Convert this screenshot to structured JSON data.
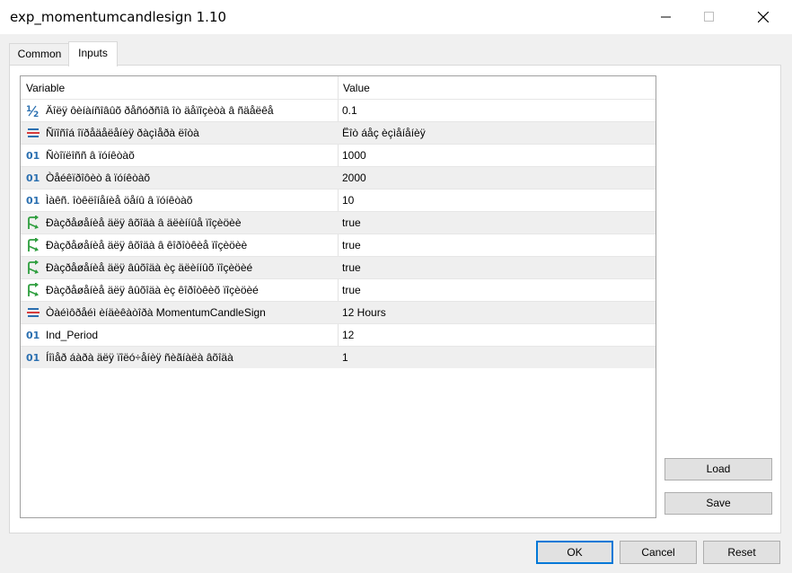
{
  "window": {
    "title": "exp_momentumcandlesign 1.10"
  },
  "tabs": [
    {
      "label": "Common",
      "active": false
    },
    {
      "label": "Inputs",
      "active": true
    }
  ],
  "grid": {
    "columns": {
      "variable": "Variable",
      "value": "Value"
    },
    "rows": [
      {
        "icon": "half-fraction-icon",
        "name": "Äîëÿ ôèíàíñîâûõ ðåñóðñîâ îò äåïîçèòà â ñäåëêå",
        "value": "0.1"
      },
      {
        "icon": "enum-list-icon",
        "name": "Ñïîñîá îïðåäåëåíèÿ ðàçìåðà ëîòà",
        "value": "Ëîò áåç èçìåíåíèÿ"
      },
      {
        "icon": "integer-icon",
        "name": "Ñòîïëîññ â ïóíêòàõ",
        "value": "1000"
      },
      {
        "icon": "integer-icon",
        "name": "Òåéêïðîôèò â ïóíêòàõ",
        "value": "2000"
      },
      {
        "icon": "integer-icon",
        "name": "Ìàêñ. îòêëîíåíèå öåíû â ïóíêòàõ",
        "value": "10"
      },
      {
        "icon": "bool-arrow-icon",
        "name": "Ðàçðåøåíèå äëÿ âõîäà â äëèííûå ïîçèöèè",
        "value": "true"
      },
      {
        "icon": "bool-arrow-icon",
        "name": "Ðàçðåøåíèå äëÿ âõîäà â êîðîòêèå ïîçèöèè",
        "value": "true"
      },
      {
        "icon": "bool-arrow-icon",
        "name": "Ðàçðåøåíèå äëÿ âûõîäà èç äëèííûõ ïîçèöèé",
        "value": "true"
      },
      {
        "icon": "bool-arrow-icon",
        "name": "Ðàçðåøåíèå äëÿ âûõîäà èç êîðîòêèõ ïîçèöèé",
        "value": "true"
      },
      {
        "icon": "enum-list-icon",
        "name": "Òàéìôðåéì èíäèêàòîðà MomentumCandleSign",
        "value": "12 Hours"
      },
      {
        "icon": "integer-icon",
        "name": "Ind_Period",
        "value": "12"
      },
      {
        "icon": "integer-icon",
        "name": "Íîìåð áàðà äëÿ ïîëó÷åíèÿ ñèãíàëà âõîäà",
        "value": "1"
      }
    ]
  },
  "side_buttons": {
    "load": "Load",
    "save": "Save"
  },
  "footer": {
    "ok": "OK",
    "cancel": "Cancel",
    "reset": "Reset"
  },
  "colors": {
    "accent": "#0078d7",
    "alt_row": "#efefef",
    "icon_blue": "#2a6fb0",
    "icon_green": "#2e9e3e",
    "icon_red": "#d83b3b"
  }
}
